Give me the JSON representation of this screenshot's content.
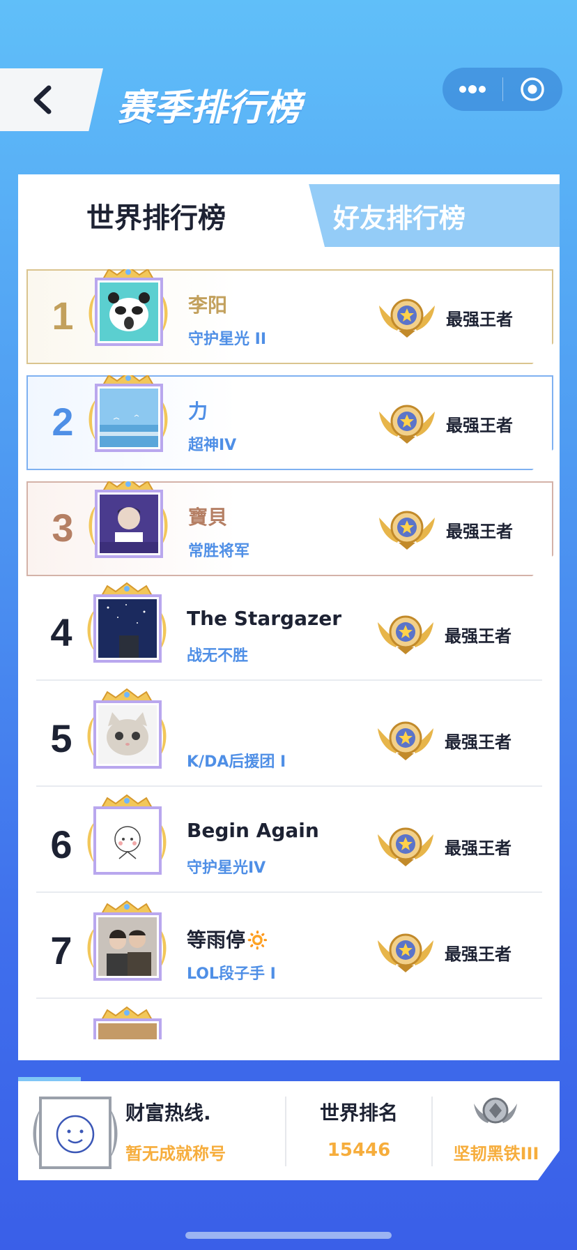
{
  "header": {
    "title": "赛季排行榜"
  },
  "tabs": {
    "world": "世界排行榜",
    "friends": "好友排行榜",
    "active": "world"
  },
  "players": [
    {
      "rank": "1",
      "name": "李阳",
      "title": "守护星光 II",
      "tier": "最强王者"
    },
    {
      "rank": "2",
      "name": "力",
      "title": "超神IV",
      "tier": "最强王者"
    },
    {
      "rank": "3",
      "name": "寶貝",
      "title": "常胜将军",
      "tier": "最强王者"
    },
    {
      "rank": "4",
      "name": "The Stargazer",
      "title": "战无不胜",
      "tier": "最强王者"
    },
    {
      "rank": "5",
      "name": "",
      "title": "K/DA后援团 I",
      "tier": "最强王者"
    },
    {
      "rank": "6",
      "name": "Begin Again",
      "title": "守护星光IV",
      "tier": "最强王者"
    },
    {
      "rank": "7",
      "name": "等雨停🔅",
      "title": "LOL段子手 I",
      "tier": "最强王者"
    }
  ],
  "me": {
    "name": "财富热线.",
    "title": "暂无成就称号",
    "rank_label": "世界排名",
    "rank_value": "15446",
    "tier": "坚韧黑铁III"
  },
  "colors": {
    "gold": "#c2a05c",
    "blue": "#4f8fe6",
    "bronze": "#b57f64",
    "orange": "#f6ad3c"
  }
}
